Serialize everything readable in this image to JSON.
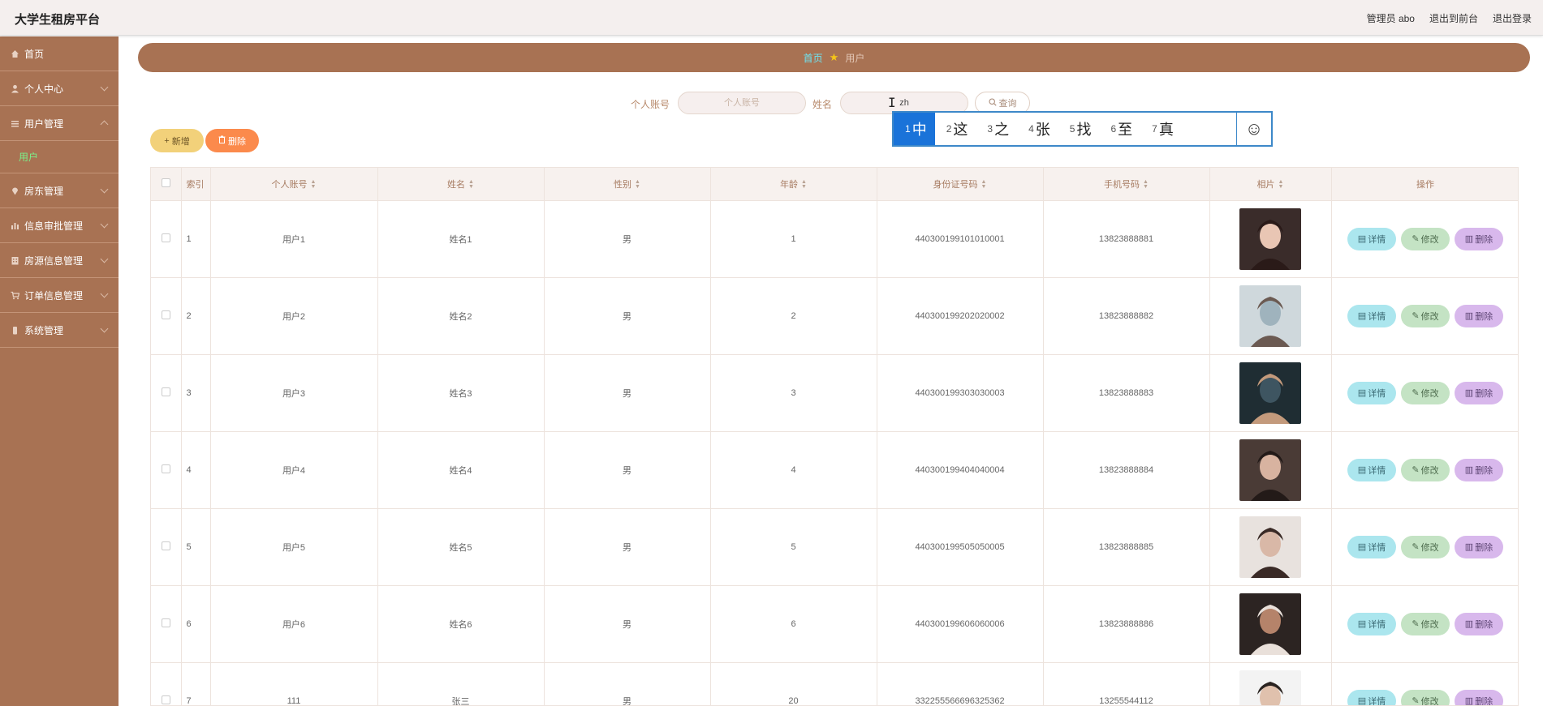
{
  "app": {
    "title": "大学生租房平台"
  },
  "header": {
    "admin": "管理员 abo",
    "back_front": "退出到前台",
    "logout": "退出登录"
  },
  "sidebar": {
    "items": [
      {
        "label": "首页",
        "icon": "home-icon"
      },
      {
        "label": "个人中心",
        "icon": "user-icon"
      },
      {
        "label": "用户管理",
        "icon": "users-icon"
      },
      {
        "label": "房东管理",
        "icon": "location-icon"
      },
      {
        "label": "信息审批管理",
        "icon": "chart-icon"
      },
      {
        "label": "房源信息管理",
        "icon": "building-icon"
      },
      {
        "label": "订单信息管理",
        "icon": "cart-icon"
      },
      {
        "label": "系统管理",
        "icon": "device-icon"
      }
    ],
    "sub_item": "用户"
  },
  "breadcrumb": {
    "home": "首页",
    "current": "用户"
  },
  "search": {
    "account_label": "个人账号",
    "account_placeholder": "个人账号",
    "name_label": "姓名",
    "name_value": "zh",
    "query_label": "查询"
  },
  "actions": {
    "add": "新增",
    "delete": "删除"
  },
  "table": {
    "headers": [
      "索引",
      "个人账号",
      "姓名",
      "性别",
      "年龄",
      "身份证号码",
      "手机号码",
      "相片",
      "操作"
    ],
    "row_actions": {
      "detail": "详情",
      "edit": "修改",
      "delete": "删除"
    },
    "rows": [
      {
        "index": "1",
        "account": "用户1",
        "name": "姓名1",
        "gender": "男",
        "age": "1",
        "id_card": "440300199101010001",
        "phone": "13823888881"
      },
      {
        "index": "2",
        "account": "用户2",
        "name": "姓名2",
        "gender": "男",
        "age": "2",
        "id_card": "440300199202020002",
        "phone": "13823888882"
      },
      {
        "index": "3",
        "account": "用户3",
        "name": "姓名3",
        "gender": "男",
        "age": "3",
        "id_card": "440300199303030003",
        "phone": "13823888883"
      },
      {
        "index": "4",
        "account": "用户4",
        "name": "姓名4",
        "gender": "男",
        "age": "4",
        "id_card": "440300199404040004",
        "phone": "13823888884"
      },
      {
        "index": "5",
        "account": "用户5",
        "name": "姓名5",
        "gender": "男",
        "age": "5",
        "id_card": "440300199505050005",
        "phone": "13823888885"
      },
      {
        "index": "6",
        "account": "用户6",
        "name": "姓名6",
        "gender": "男",
        "age": "6",
        "id_card": "440300199606060006",
        "phone": "13823888886"
      },
      {
        "index": "7",
        "account": "111",
        "name": "张三",
        "gender": "男",
        "age": "20",
        "id_card": "332255566696325362",
        "phone": "13255544112"
      }
    ]
  },
  "ime": {
    "candidates": [
      {
        "num": "1",
        "char": "中"
      },
      {
        "num": "2",
        "char": "这"
      },
      {
        "num": "3",
        "char": "之"
      },
      {
        "num": "4",
        "char": "张"
      },
      {
        "num": "5",
        "char": "找"
      },
      {
        "num": "6",
        "char": "至"
      },
      {
        "num": "7",
        "char": "真"
      }
    ],
    "emoji": "☺"
  },
  "colors": {
    "brand": "#a87253",
    "active_sub": "#7cf08a",
    "add_button": "#f2d17a",
    "delete_button": "#fb8a4c",
    "detail_button": "#abe6ee",
    "edit_button": "#c4e3c4",
    "row_delete_button": "#d8b8ec",
    "ime_selected": "#1a73d9"
  }
}
